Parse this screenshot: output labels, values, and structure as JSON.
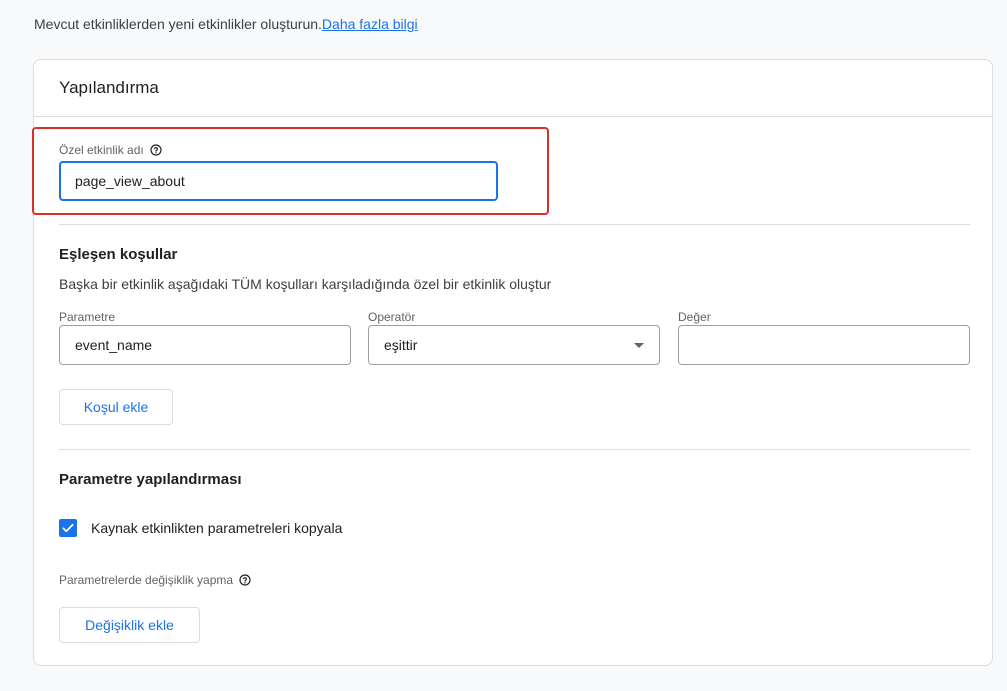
{
  "intro": {
    "text": "Mevcut etkinliklerden yeni etkinlikler oluşturun.",
    "link": "Daha fazla bilgi"
  },
  "card": {
    "title": "Yapılandırma"
  },
  "event_name": {
    "label": "Özel etkinlik adı",
    "value": "page_view_about"
  },
  "matching": {
    "title": "Eşleşen koşullar",
    "description": "Başka bir etkinlik aşağıdaki TÜM koşulları karşıladığında özel bir etkinlik oluştur",
    "parameter_label": "Parametre",
    "parameter_value": "event_name",
    "operator_label": "Operatör",
    "operator_value": "eşittir",
    "value_label": "Değer",
    "value_value": "",
    "add_condition": "Koşul ekle"
  },
  "param_config": {
    "title": "Parametre yapılandırması",
    "copy_checkbox_label": "Kaynak etkinlikten parametreleri kopyala",
    "copy_checked": true,
    "modify_label": "Parametrelerde değişiklik yapma",
    "add_modification": "Değişiklik ekle"
  },
  "colors": {
    "accent": "#1a73e8",
    "highlight": "#d93025"
  }
}
